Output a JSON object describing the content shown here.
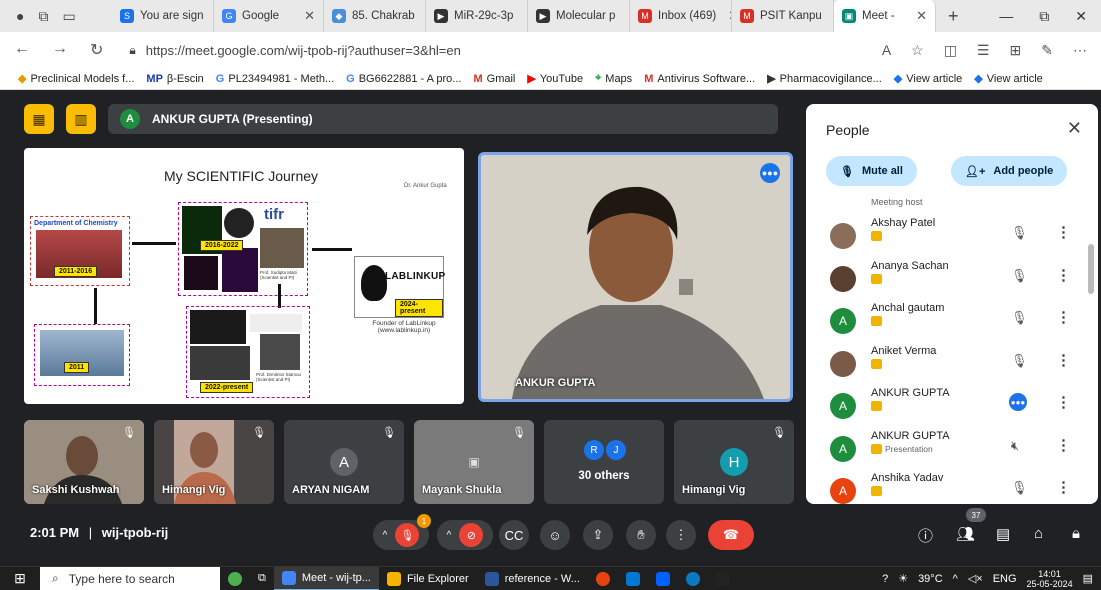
{
  "browser": {
    "tabs": [
      {
        "label": "You are sign",
        "color": "#1a73e8",
        "icon": "S"
      },
      {
        "label": "Google",
        "color": "#4285f4",
        "icon": "G"
      },
      {
        "label": "85. Chakrab",
        "color": "#4a90d9",
        "icon": "◆"
      },
      {
        "label": "MiR-29c-3p",
        "color": "#333333",
        "icon": "▶"
      },
      {
        "label": "Molecular p",
        "color": "#333333",
        "icon": "▶"
      },
      {
        "label": "Inbox (469)",
        "color": "#d93025",
        "icon": "M"
      },
      {
        "label": "PSIT Kanpu",
        "color": "#d93025",
        "icon": "M"
      },
      {
        "label": "Meet - ",
        "color": "#00897b",
        "icon": "▣"
      }
    ],
    "url": "https://meet.google.com/wij-tpob-rij?authuser=3&hl=en",
    "bookmarks": [
      {
        "label": "Preclinical Models f...",
        "icon": "◆"
      },
      {
        "label": "β-Escin",
        "icon": "MP"
      },
      {
        "label": "PL23494981 - Meth...",
        "icon": "G"
      },
      {
        "label": "BG6622881 - A pro...",
        "icon": "G"
      },
      {
        "label": "Gmail",
        "icon": "M"
      },
      {
        "label": "YouTube",
        "icon": "▶"
      },
      {
        "label": "Maps",
        "icon": "⌖"
      },
      {
        "label": "Antivirus Software...",
        "icon": "M"
      },
      {
        "label": "Pharmacovigilance...",
        "icon": "▶"
      },
      {
        "label": "View article",
        "icon": "◆"
      },
      {
        "label": "View article",
        "icon": "◆"
      }
    ]
  },
  "meet": {
    "presenter_initial": "A",
    "presenter_label": "ANKUR GUPTA (Presenting)",
    "slide": {
      "title": "My SCIENTIFIC Journey",
      "author": "Dr. Ankur Gupta",
      "dept": "Department of Chemistry",
      "years": [
        "2011-2016",
        "2016-2022",
        "2024-present",
        "2011",
        "2022-present"
      ],
      "tifr": "tifr",
      "lablink": "LABLINKUP",
      "founder": "Founder of LabLinkup (www.lablinkup.in)",
      "caption1": "Prof. Sudipta Maiti (Scientist and PI)",
      "caption2": "Prof. Dimitrios Stamou (Scientist and PI)"
    },
    "speaker_name": "ANKUR GUPTA",
    "tiles": [
      {
        "name": "Sakshi Kushwah",
        "type": "video"
      },
      {
        "name": "Himangi Vig",
        "type": "video"
      },
      {
        "name": "ARYAN NIGAM",
        "type": "avatar",
        "initial": "A",
        "color": "#5f6368"
      },
      {
        "name": "Mayank Shukla",
        "type": "image"
      },
      {
        "name": "30 others",
        "type": "others",
        "initials": [
          "R",
          "J"
        ]
      },
      {
        "name": "Himangi Vig",
        "type": "avatar",
        "initial": "H",
        "color": "#129eaf"
      }
    ],
    "time": "2:01 PM",
    "separator": "|",
    "meeting_code": "wij-tpob-rij",
    "reaction_badge": "1",
    "participant_count": "37"
  },
  "people": {
    "title": "People",
    "mute_all": "Mute all",
    "add_people": "Add people",
    "meeting_host": "Meeting host",
    "list": [
      {
        "name": "Akshay Patel",
        "sub": "",
        "initial": "",
        "color": "#8a6d5a",
        "mic": "muted"
      },
      {
        "name": "Ananya Sachan",
        "sub": "",
        "initial": "",
        "color": "#5a4030",
        "mic": "muted"
      },
      {
        "name": "Anchal gautam",
        "sub": "",
        "initial": "A",
        "color": "#1e8e3e",
        "mic": "muted"
      },
      {
        "name": "Aniket Verma",
        "sub": "",
        "initial": "",
        "color": "#7a5a48",
        "mic": "muted"
      },
      {
        "name": "ANKUR GUPTA",
        "sub": "",
        "initial": "A",
        "color": "#1e8e3e",
        "mic": "speaking"
      },
      {
        "name": "ANKUR GUPTA",
        "sub": "Presentation",
        "initial": "A",
        "color": "#1e8e3e",
        "mic": "presentation"
      },
      {
        "name": "Anshika Yadav",
        "sub": "",
        "initial": "A",
        "color": "#e8430e",
        "mic": "muted"
      }
    ]
  },
  "taskbar": {
    "search_placeholder": "Type here to search",
    "items": [
      {
        "label": "Meet - wij-tp...",
        "color": "#4285f4",
        "active": true
      },
      {
        "label": "File Explorer",
        "color": "#f4b400",
        "active": false
      },
      {
        "label": "reference - W...",
        "color": "#2b579a",
        "active": false
      }
    ],
    "weather": "39°C",
    "lang": "ENG",
    "time": "14:01",
    "date": "25-05-2024"
  }
}
